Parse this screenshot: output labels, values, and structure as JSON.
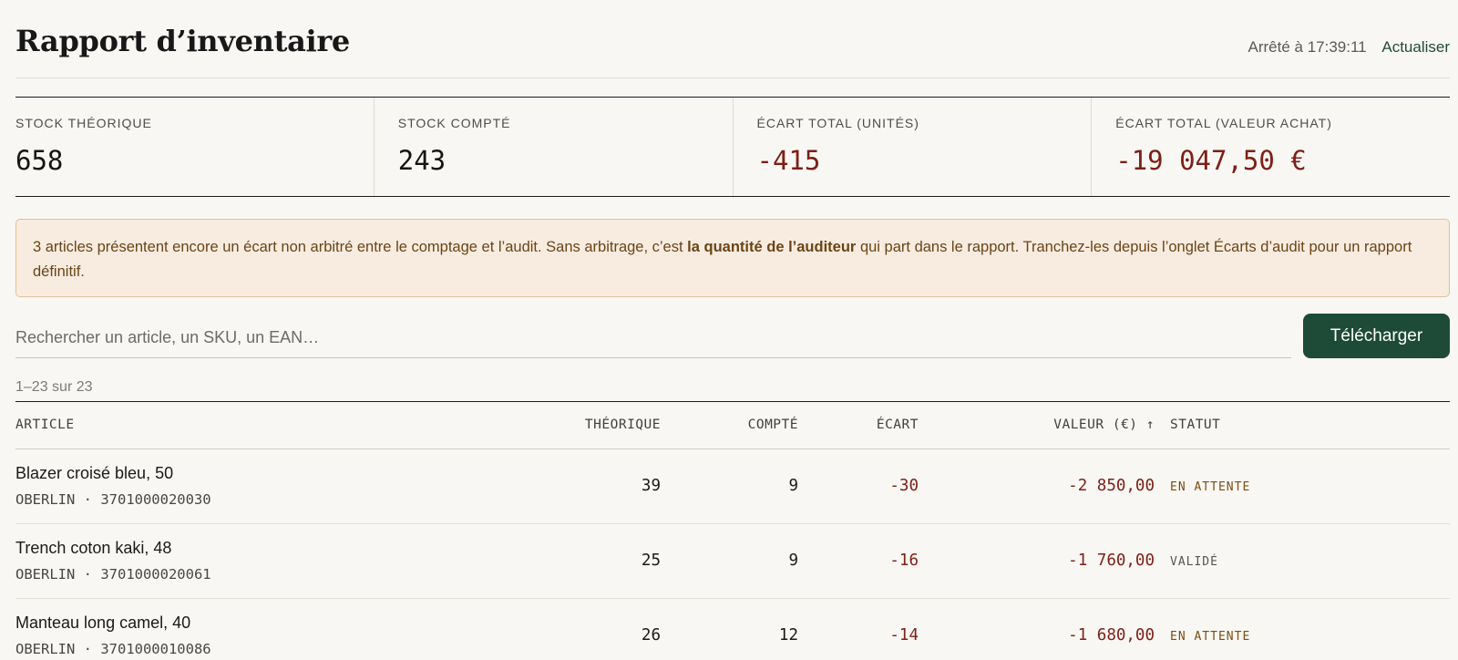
{
  "header": {
    "title": "Rapport d’inventaire",
    "timestamp": "Arrêté à 17:39:11",
    "refresh_label": "Actualiser"
  },
  "stats": [
    {
      "label": "STOCK THÉORIQUE",
      "value": "658"
    },
    {
      "label": "STOCK COMPTÉ",
      "value": "243"
    },
    {
      "label": "ÉCART TOTAL (UNITÉS)",
      "value": "-415"
    },
    {
      "label": "ÉCART TOTAL (VALEUR ACHAT)",
      "value": "-19 047,50 €"
    }
  ],
  "alert": {
    "text_before": "3 articles présentent encore un écart non arbitré entre le comptage et l’audit. Sans arbitrage, c’est ",
    "text_bold": "la quantité de l’auditeur",
    "text_after": " qui part dans le rapport. Tranchez-les depuis l’onglet Écarts d’audit pour un rapport définitif."
  },
  "search": {
    "placeholder": "Rechercher un article, un SKU, un EAN…",
    "value": ""
  },
  "download_label": "Télécharger",
  "count_label": "1–23 sur 23",
  "table": {
    "headers": {
      "article": "ARTICLE",
      "theorique": "THÉORIQUE",
      "compte": "COMPTÉ",
      "ecart": "ÉCART",
      "valeur": "VALEUR (€) ↑",
      "statut": "STATUT"
    },
    "rows": [
      {
        "name": "Blazer croisé bleu, 50",
        "sub": "OBERLIN · 3701000020030",
        "theorique": "39",
        "compte": "9",
        "ecart": "-30",
        "valeur": "-2 850,00",
        "statut": "EN ATTENTE"
      },
      {
        "name": "Trench coton kaki, 48",
        "sub": "OBERLIN · 3701000020061",
        "theorique": "25",
        "compte": "9",
        "ecart": "-16",
        "valeur": "-1 760,00",
        "statut": "VALIDÉ"
      },
      {
        "name": "Manteau long camel, 40",
        "sub": "OBERLIN · 3701000010086",
        "theorique": "26",
        "compte": "12",
        "ecart": "-14",
        "valeur": "-1 680,00",
        "statut": "EN ATTENTE"
      }
    ]
  },
  "colors": {
    "accent": "#1d4b38",
    "negative": "#7d1f16",
    "alert_bg": "#f8ece0",
    "alert_text": "#6b4416",
    "pending": "#7b4e12"
  }
}
